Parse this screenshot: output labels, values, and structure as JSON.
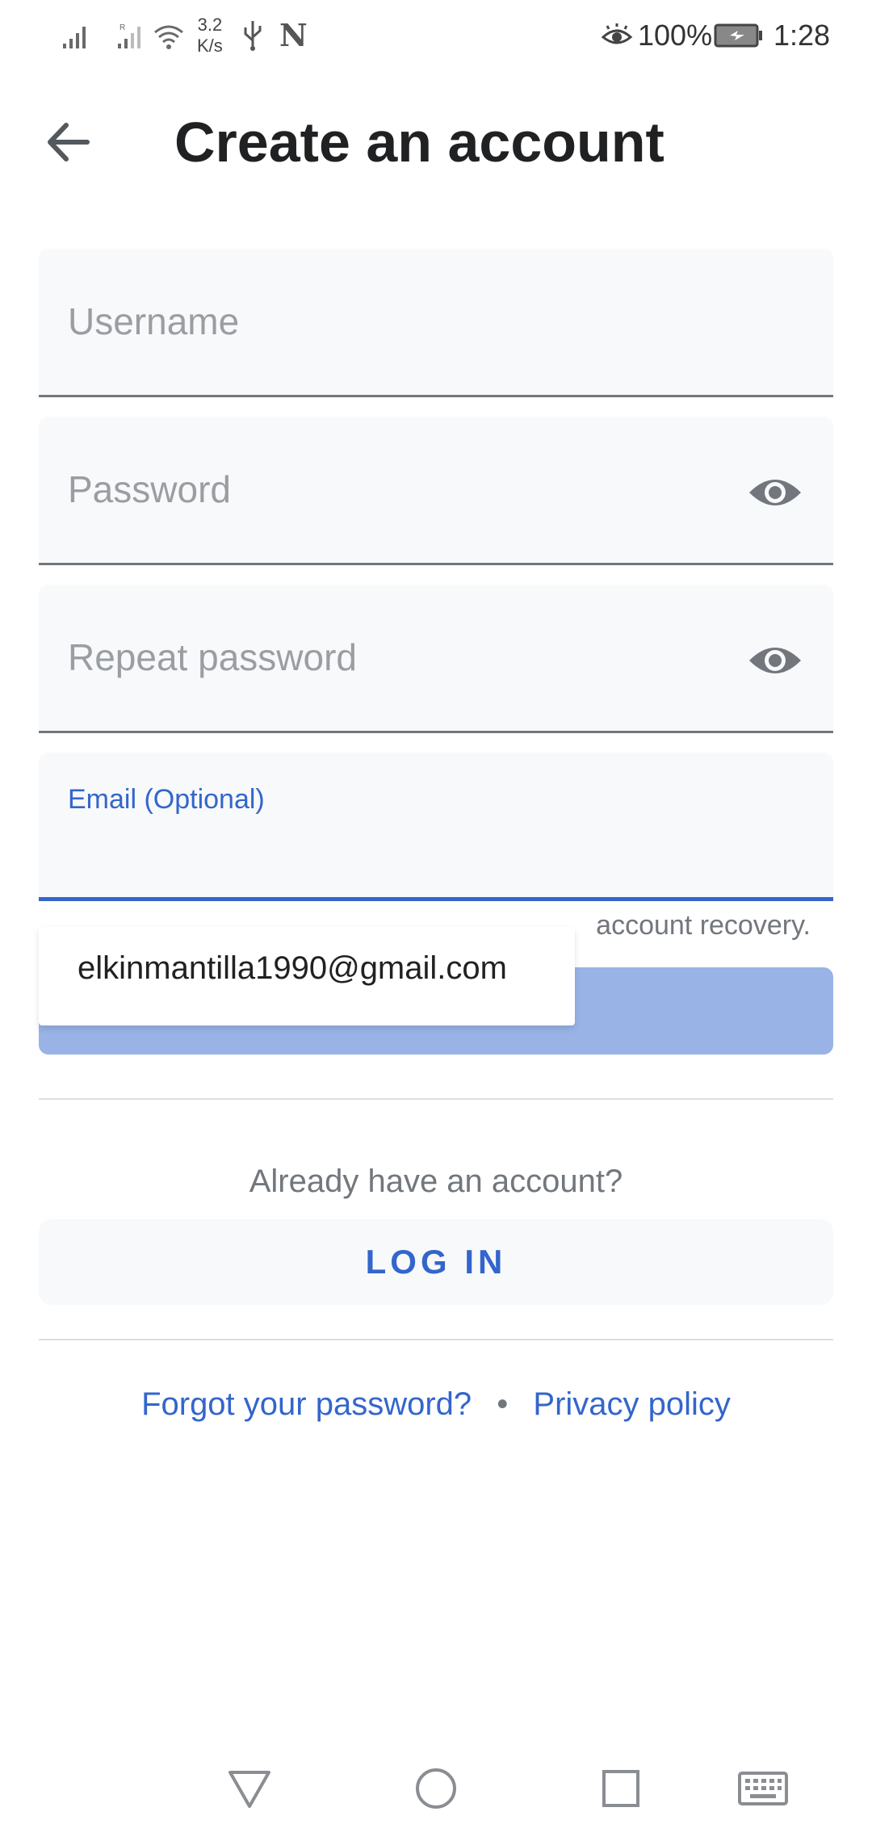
{
  "status_bar": {
    "net_speed_value": "3.2",
    "net_speed_unit": "K/s",
    "network_badge": "N",
    "battery_percent": "100%",
    "time": "1:28"
  },
  "header": {
    "back_icon": "arrow-left-icon",
    "title": "Create an account"
  },
  "form": {
    "username": {
      "placeholder": "Username"
    },
    "password": {
      "placeholder": "Password",
      "toggle_icon": "eye-icon"
    },
    "repeat_password": {
      "placeholder": "Repeat password",
      "toggle_icon": "eye-icon"
    },
    "email": {
      "label": "Email (Optional)",
      "value": ""
    },
    "helper_text": "account recovery."
  },
  "autofill": {
    "suggestion": "elkinmantilla1990@gmail.com"
  },
  "login_section": {
    "prompt": "Already have an account?",
    "login_label": "LOG IN"
  },
  "footer": {
    "forgot_password": "Forgot your password?",
    "separator": "•",
    "privacy_policy": "Privacy policy"
  },
  "nav_bar": {
    "icons": [
      "back-triangle-icon",
      "home-circle-icon",
      "recents-square-icon",
      "keyboard-icon"
    ]
  },
  "colors": {
    "accent": "#3366cc",
    "button_disabled": "#99b3e6",
    "field_bg": "#f8f9fa"
  }
}
